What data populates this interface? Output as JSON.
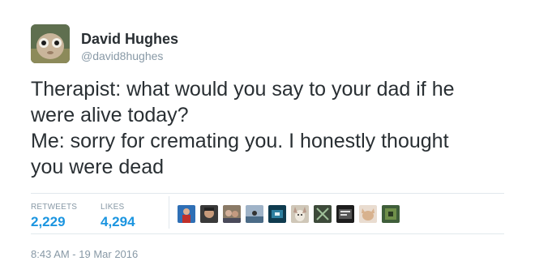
{
  "author": {
    "display_name": "David Hughes",
    "username": "@david8hughes",
    "avatar_icon": "avatar-photo"
  },
  "tweet": {
    "lines": [
      "Therapist: what would you say to your dad if he",
      "were alive today?",
      "Me: sorry for cremating you. I honestly thought",
      "you were dead"
    ]
  },
  "stats": {
    "retweets_label": "RETWEETS",
    "retweets_count": "2,229",
    "likes_label": "LIKES",
    "likes_count": "4,294"
  },
  "likers": [
    {
      "icon": "liker-avatar-1"
    },
    {
      "icon": "liker-avatar-2"
    },
    {
      "icon": "liker-avatar-3"
    },
    {
      "icon": "liker-avatar-4"
    },
    {
      "icon": "liker-avatar-5"
    },
    {
      "icon": "liker-avatar-6"
    },
    {
      "icon": "liker-avatar-7"
    },
    {
      "icon": "liker-avatar-8"
    },
    {
      "icon": "liker-avatar-9"
    },
    {
      "icon": "liker-avatar-10"
    }
  ],
  "timestamp": "8:43 AM - 19 Mar 2016",
  "colors": {
    "link_blue": "#1b95e0",
    "muted_gray": "#8899a6",
    "text_dark": "#292f33",
    "divider": "#e1e8ed"
  }
}
